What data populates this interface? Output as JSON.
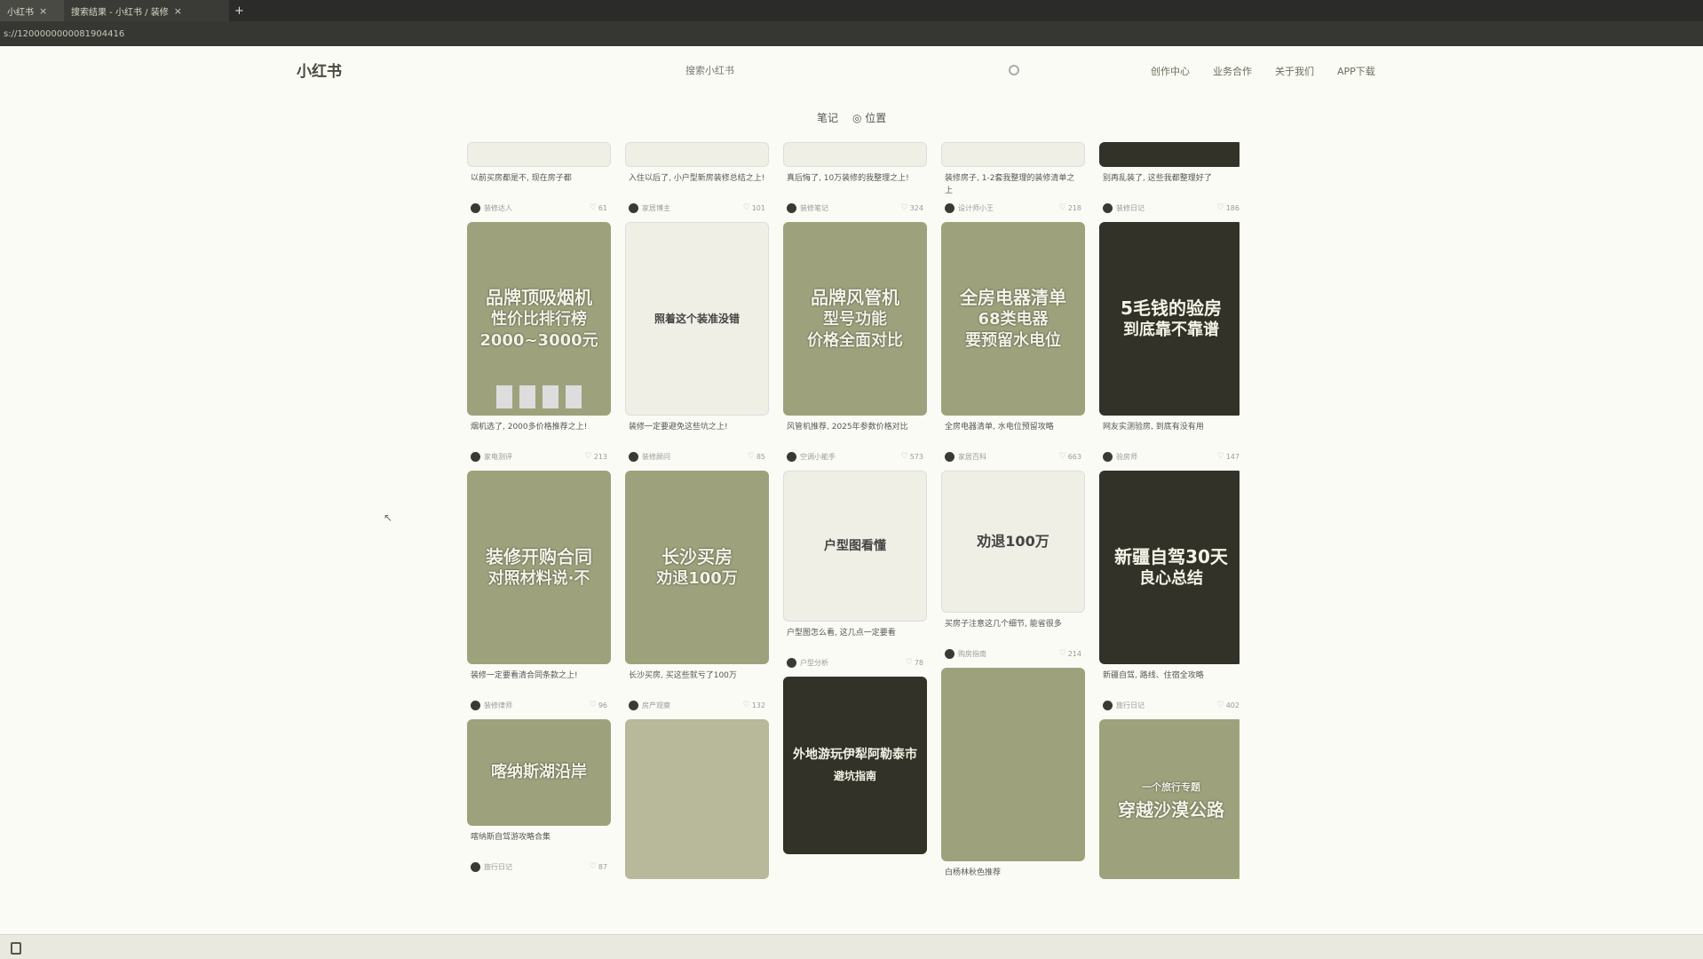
{
  "browser": {
    "tabs": [
      {
        "label": "小红书"
      },
      {
        "label": "搜索结果 - 小红书 / 装修"
      }
    ],
    "close_symbol": "×",
    "new_tab_symbol": "+",
    "url": "s://1200000000081904416"
  },
  "header": {
    "logo": "小红书",
    "search_placeholder": "搜索小红书",
    "nav": [
      "创作中心",
      "业务合作",
      "关于我们",
      "APP下载"
    ]
  },
  "channel_tabs": [
    "笔记",
    "◎ 位置"
  ],
  "feed": {
    "top_row": [
      {
        "title": "以前买房都是不, 现在房子都",
        "author": "装修达人",
        "likes": "61"
      },
      {
        "title": "入住以后了, 小户型新房装修总结之上!",
        "author": "家居博主",
        "likes": "101"
      },
      {
        "title": "真后悔了, 10万装修的我整理之上!",
        "author": "装修笔记",
        "likes": "324"
      },
      {
        "title": "装修房子, 1-2套我整理的装修清单之上",
        "author": "设计师小王",
        "likes": "218"
      },
      {
        "title": "别再乱装了, 这些我都整理好了",
        "author": "装修日记",
        "likes": "186"
      }
    ],
    "row2": [
      {
        "cover_lines": [
          "品牌顶吸烟机",
          "性价比排行榜",
          "2000~3000元"
        ],
        "title": "烟机选了, 2000多价格推荐之上!",
        "author": "家电测评",
        "likes": "213"
      },
      {
        "cover_lines": [
          "照着这个装准没错"
        ],
        "title": "装修一定要避免这些坑之上!",
        "author": "装修顾问",
        "likes": "85"
      },
      {
        "cover_lines": [
          "品牌风管机",
          "型号功能",
          "价格全面对比"
        ],
        "title": "风管机推荐, 2025年参数价格对比",
        "author": "空调小能手",
        "likes": "573"
      },
      {
        "cover_lines": [
          "全房电器清单",
          "68类电器",
          "要预留水电位"
        ],
        "title": "全房电器清单, 水电位预留攻略",
        "author": "家居百科",
        "likes": "663"
      },
      {
        "cover_lines": [
          "5毛钱的验房",
          "到底靠不靠谱"
        ],
        "title": "网友实测验房, 到底有没有用",
        "author": "验房师",
        "likes": "147"
      }
    ],
    "row3": [
      {
        "cover_lines": [
          "装修开购合同",
          "对照材料说·不"
        ],
        "title": "装修一定要看清合同条款之上!",
        "author": "装修律师",
        "likes": "96"
      },
      {
        "cover_lines": [
          "长沙买房",
          "劝退100万"
        ],
        "title": "长沙买房, 买这些就亏了100万",
        "author": "房产观察",
        "likes": "132"
      },
      {
        "cover_lines": [
          "户型图看懂"
        ],
        "title": "户型图怎么看, 这几点一定要看",
        "author": "户型分析",
        "likes": "78"
      },
      {
        "cover_lines": [
          "劝退100万"
        ],
        "title": "买房子注意这几个细节, 能省很多",
        "author": "购房指南",
        "likes": "214"
      },
      {
        "cover_lines": [
          "新疆自驾30天",
          "良心总结"
        ],
        "title": "新疆自驾, 路线、住宿全攻略",
        "author": "旅行日记",
        "likes": "402"
      }
    ],
    "row4": [
      {
        "cover_lines": [
          "喀纳斯湖沿岸"
        ],
        "title": "喀纳斯自驾游攻略合集",
        "author": "旅行日记",
        "likes": "87"
      },
      {
        "cover_lines": [
          ""
        ],
        "title": "",
        "author": "",
        "likes": ""
      },
      {
        "cover_lines": [
          "外地游玩伊犁阿勒泰市",
          "避坑指南"
        ],
        "title": "",
        "author": "",
        "likes": ""
      },
      {
        "cover_lines": [
          ""
        ],
        "title": "白杨林秋色推荐",
        "author": "",
        "likes": ""
      },
      {
        "cover_lines": [
          "一个旅行专题",
          "穿越沙漠公路"
        ],
        "title": "",
        "author": "",
        "likes": ""
      }
    ]
  }
}
